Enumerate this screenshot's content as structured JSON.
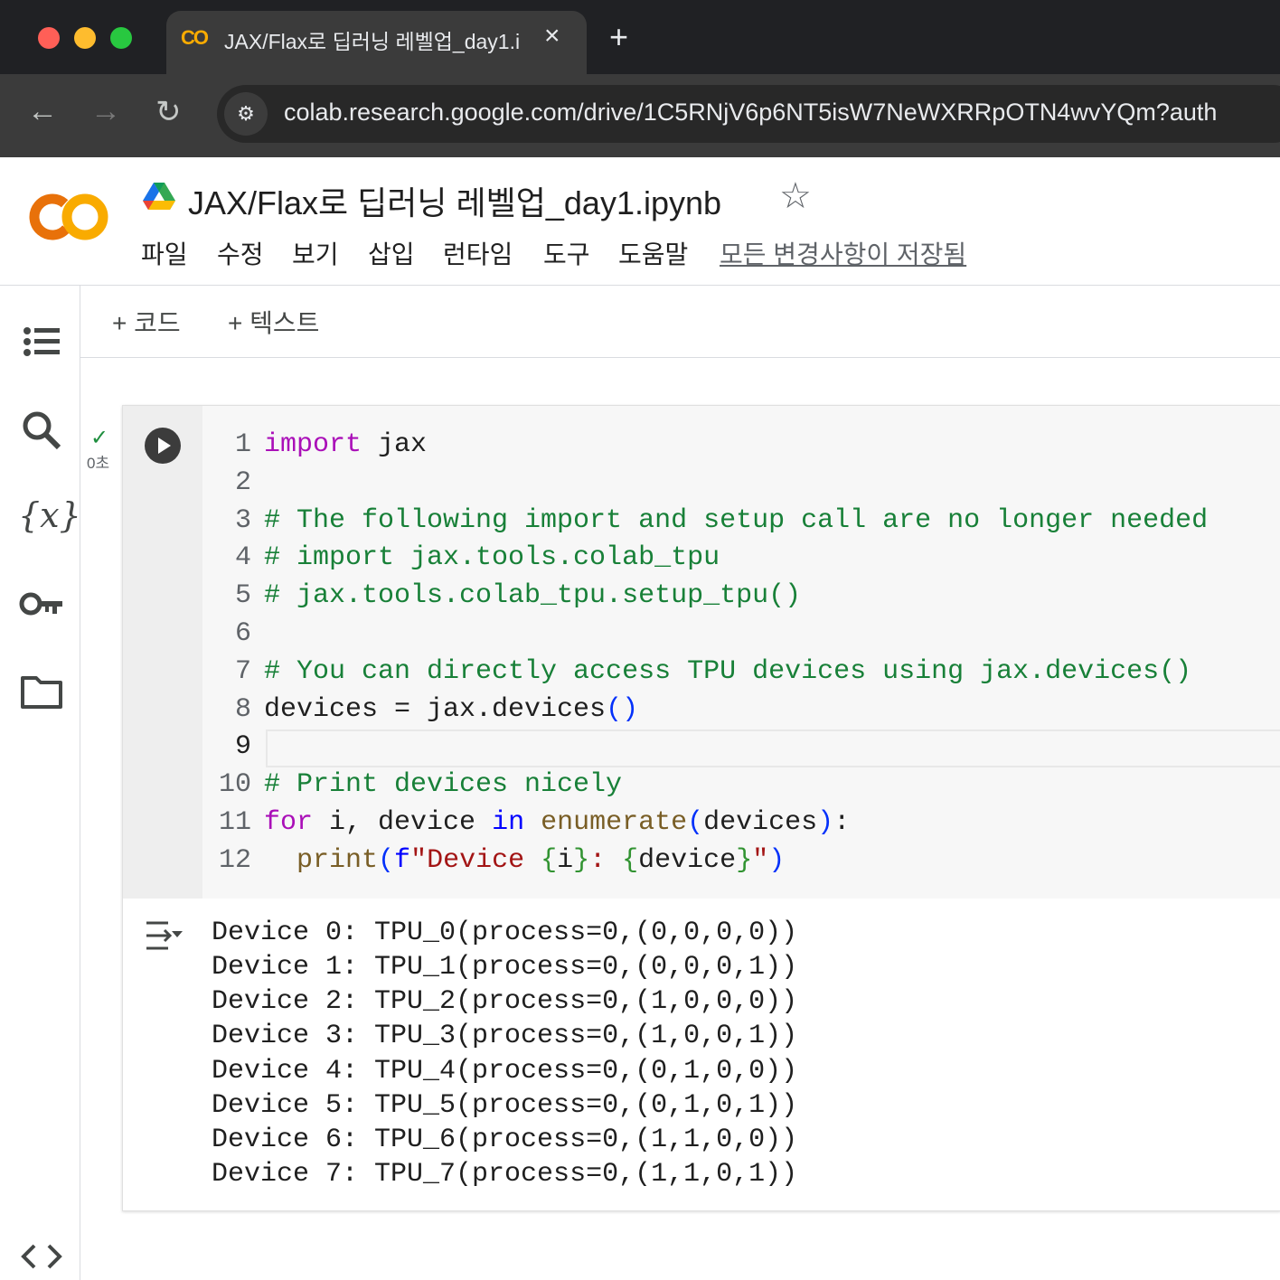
{
  "browser": {
    "tab_title": "JAX/Flax로 딥러닝 레벨업_day1.i",
    "tab_close": "×",
    "new_tab": "+",
    "url": "colab.research.google.com/drive/1C5RNjV6p6NT5isW7NeWXRRpOTN4wvYQm?auth",
    "icons": [
      "back-arrow-icon",
      "forward-arrow-icon",
      "reload-icon",
      "site-settings-icon"
    ]
  },
  "header": {
    "logo_text": "CO",
    "title": "JAX/Flax로 딥러닝 레벨업_day1.ipynb",
    "menu": [
      "파일",
      "수정",
      "보기",
      "삽입",
      "런타임",
      "도구",
      "도움말"
    ],
    "save_status": "모든 변경사항이 저장됨"
  },
  "toolbar": {
    "add_code": "+ 코드",
    "add_text": "+ 텍스트"
  },
  "sidebar": {
    "icons": [
      "table-of-contents-icon",
      "search-icon",
      "variables-icon",
      "secrets-key-icon",
      "files-folder-icon",
      "code-snippets-icon"
    ],
    "variables_label": "{x}"
  },
  "cell": {
    "exec_status": "✓",
    "exec_time": "0초",
    "line_numbers": [
      "1",
      "2",
      "3",
      "4",
      "5",
      "6",
      "7",
      "8",
      "9",
      "10",
      "11",
      "12"
    ],
    "code": [
      "import jax",
      "",
      "# The following import and setup call are no longer needed",
      "# import jax.tools.colab_tpu",
      "# jax.tools.colab_tpu.setup_tpu()",
      "",
      "# You can directly access TPU devices using jax.devices()",
      "devices = jax.devices()",
      "",
      "# Print devices nicely",
      "for i, device in enumerate(devices):",
      "  print(f\"Device {i}: {device}\")"
    ],
    "output": [
      "Device 0: TPU_0(process=0,(0,0,0,0))",
      "Device 1: TPU_1(process=0,(0,0,0,1))",
      "Device 2: TPU_2(process=0,(1,0,0,0))",
      "Device 3: TPU_3(process=0,(1,0,0,1))",
      "Device 4: TPU_4(process=0,(0,1,0,0))",
      "Device 5: TPU_5(process=0,(0,1,0,1))",
      "Device 6: TPU_6(process=0,(1,1,0,0))",
      "Device 7: TPU_7(process=0,(1,1,0,1))"
    ]
  },
  "colors": {
    "chrome_bg": "#202124",
    "colab_orange": "#f9ab00",
    "comment_green": "#188038",
    "keyword_purple": "#aa0fb8"
  }
}
